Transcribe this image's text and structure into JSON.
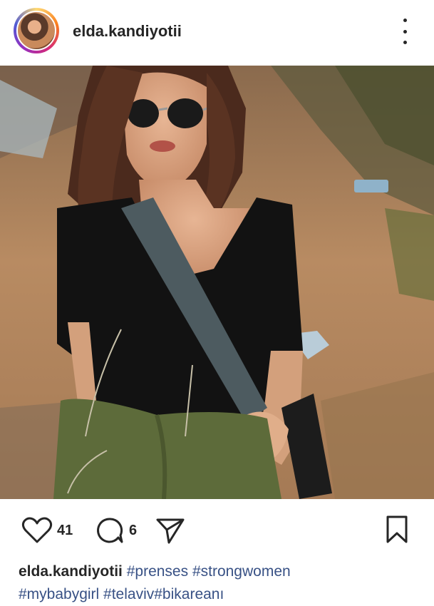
{
  "post": {
    "username": "elda.kandiyotii",
    "likes": "41",
    "comments": "6",
    "caption_user": "elda.kandiyotii",
    "hashtags_line1": "#prenses #strongwomen",
    "hashtags_line2": "#mybabygirl #telaviv#bikareanı"
  },
  "icons": {
    "more": "more-options-icon",
    "like": "heart-icon",
    "comment": "comment-icon",
    "share": "send-icon",
    "save": "bookmark-icon"
  },
  "colors": {
    "text": "#262626",
    "hashtag": "#385185",
    "background": "#ffffff"
  }
}
